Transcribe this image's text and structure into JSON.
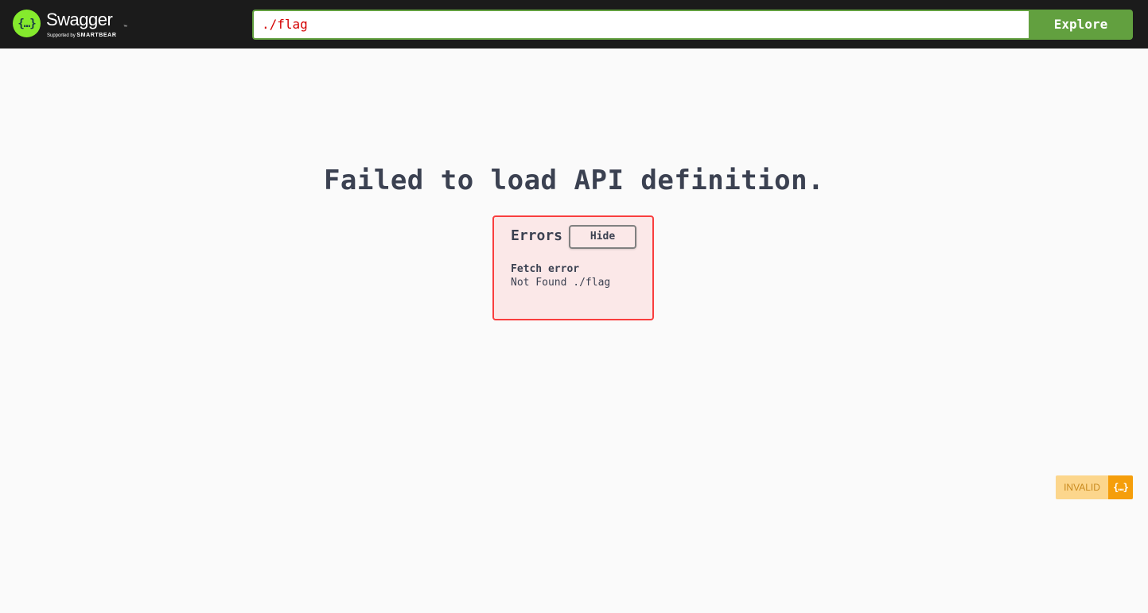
{
  "header": {
    "brand_glyph": "{…}",
    "brand_name": "Swagger",
    "brand_tm": "™",
    "brand_sub_prefix": "Supported by",
    "brand_sub_company": "SMARTBEAR",
    "brand_color": "#85ea2d",
    "url_value": "./flag",
    "explore_label": "Explore",
    "accent_color": "#62a03f"
  },
  "main": {
    "title": "Failed to load API definition."
  },
  "errors": {
    "heading": "Errors",
    "hide_label": "Hide",
    "items": [
      {
        "type": "Fetch error",
        "message": "Not Found ./flag"
      }
    ],
    "border_color": "#f93e3e"
  },
  "validator": {
    "label": "INVALID",
    "icon_glyph": "{…}",
    "icon": "swagger-validator-icon"
  }
}
